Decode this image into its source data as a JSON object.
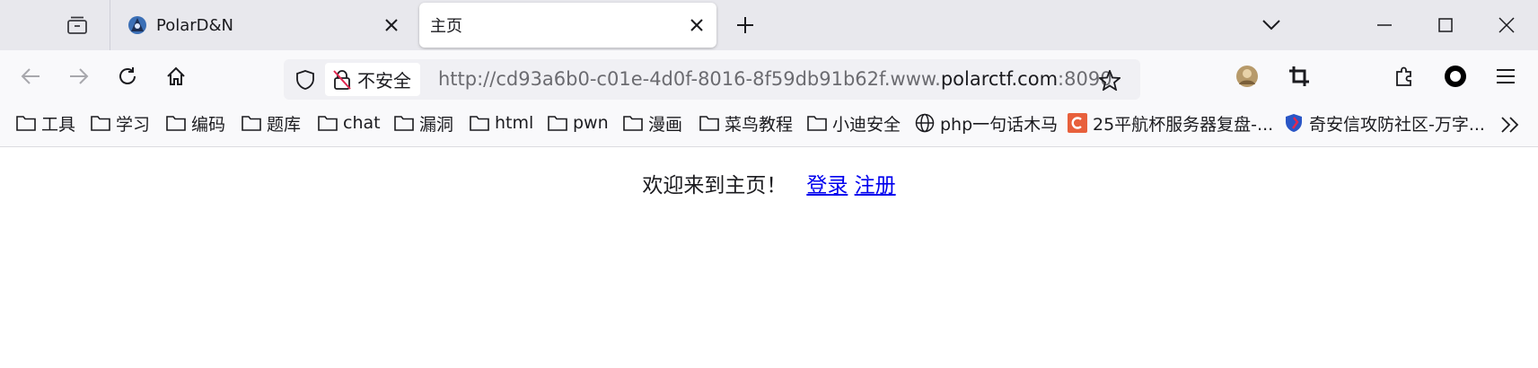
{
  "browser": {
    "tabs": [
      {
        "title": "PolarD&N",
        "active": false,
        "favicon": "polar-hood-icon"
      },
      {
        "title": "主页",
        "active": true,
        "favicon": ""
      }
    ],
    "window_controls": [
      "minimize-icon",
      "maximize-icon",
      "close-icon"
    ]
  },
  "navbar": {
    "insecure_label": "不安全",
    "url_prefix": "http://cd93a6b0-c01e-4d0f-8016-8f59db91b62f.www.",
    "url_host": "polarctf.com",
    "url_suffix": ":8090"
  },
  "bookmarks": [
    {
      "label": "工具",
      "icon": "folder-icon"
    },
    {
      "label": "学习",
      "icon": "folder-icon"
    },
    {
      "label": "编码",
      "icon": "folder-icon"
    },
    {
      "label": "题库",
      "icon": "folder-icon"
    },
    {
      "label": "chat",
      "icon": "folder-icon"
    },
    {
      "label": "漏洞",
      "icon": "folder-icon"
    },
    {
      "label": "html",
      "icon": "folder-icon"
    },
    {
      "label": "pwn",
      "icon": "folder-icon"
    },
    {
      "label": "漫画",
      "icon": "folder-icon"
    },
    {
      "label": "菜鸟教程",
      "icon": "folder-icon"
    },
    {
      "label": "小迪安全",
      "icon": "folder-icon"
    },
    {
      "label": "php一句话木马",
      "icon": "globe-icon"
    },
    {
      "label": "25平航杯服务器复盘-...",
      "icon": "c-logo-icon"
    },
    {
      "label": "奇安信攻防社区-万字...",
      "icon": "qax-shield-icon"
    }
  ],
  "page": {
    "welcome_text": "欢迎来到主页！",
    "login_link": "登录",
    "register_link": "注册"
  },
  "colors": {
    "tabstrip_bg": "#e8e8ed",
    "toolbar_bg": "#f9f9fb",
    "link": "#0000ee",
    "c_logo": "#e8603c"
  }
}
